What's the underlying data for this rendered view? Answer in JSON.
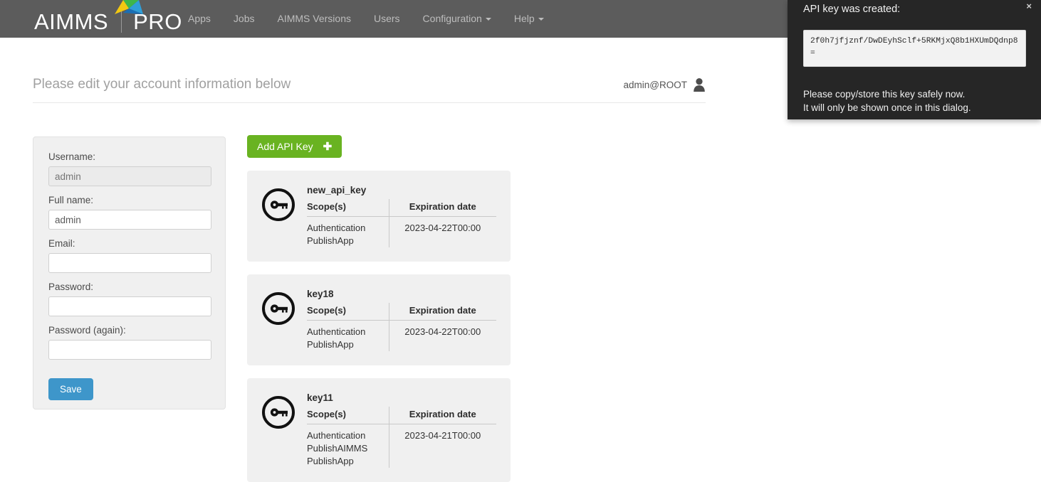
{
  "navbar": {
    "brand_primary": "AIMMS",
    "brand_secondary": "PRO",
    "logo_icon": "aimms-arrow-logo",
    "links": [
      {
        "label": "Apps",
        "has_caret": false
      },
      {
        "label": "Jobs",
        "has_caret": false
      },
      {
        "label": "AIMMS Versions",
        "has_caret": false
      },
      {
        "label": "Users",
        "has_caret": false
      },
      {
        "label": "Configuration",
        "has_caret": true
      },
      {
        "label": "Help",
        "has_caret": true
      }
    ],
    "background_color": "#5c5c5c"
  },
  "page_header": {
    "title": "Please edit your account information below",
    "user_name": "admin@ROOT",
    "user_icon": "user-avatar-icon"
  },
  "account_form": {
    "fields": [
      {
        "label": "Username:",
        "value": "admin",
        "placeholder": "",
        "readonly": true,
        "type": "text"
      },
      {
        "label": "Full name:",
        "value": "admin",
        "placeholder": "",
        "readonly": false,
        "type": "text"
      },
      {
        "label": "Email:",
        "value": "",
        "placeholder": "",
        "readonly": false,
        "type": "text"
      },
      {
        "label": "Password:",
        "value": "",
        "placeholder": "",
        "readonly": false,
        "type": "password"
      },
      {
        "label": "Password (again):",
        "value": "",
        "placeholder": "",
        "readonly": false,
        "type": "password"
      }
    ],
    "save_label": "Save",
    "save_color": "#3e96ca"
  },
  "api_keys_section": {
    "add_button_label": "Add API Key",
    "add_button_icon": "plus-icon",
    "add_button_color": "#69b321",
    "column_headers": {
      "scopes": "Scope(s)",
      "expiration": "Expiration date"
    },
    "cards": [
      {
        "name": "new_api_key",
        "icon": "key-circle-icon",
        "scopes": [
          "Authentication",
          "PublishApp"
        ],
        "expiration": "2023-04-22T00:00"
      },
      {
        "name": "key18",
        "icon": "key-circle-icon",
        "scopes": [
          "Authentication",
          "PublishApp"
        ],
        "expiration": "2023-04-22T00:00"
      },
      {
        "name": "key11",
        "icon": "key-circle-icon",
        "scopes": [
          "Authentication",
          "PublishAIMMS",
          "PublishApp"
        ],
        "expiration": "2023-04-21T00:00"
      }
    ]
  },
  "api_key_dialog": {
    "title": "API key was created:",
    "close_label": "×",
    "key_value": "2f0h7jfjznf/DwDEyhSclf+5RKMjxQ8b1HXUmDQdnp8=",
    "note_line1": "Please copy/store this key safely now.",
    "note_line2": "It will only be shown once in this dialog.",
    "background_color": "#262626"
  }
}
